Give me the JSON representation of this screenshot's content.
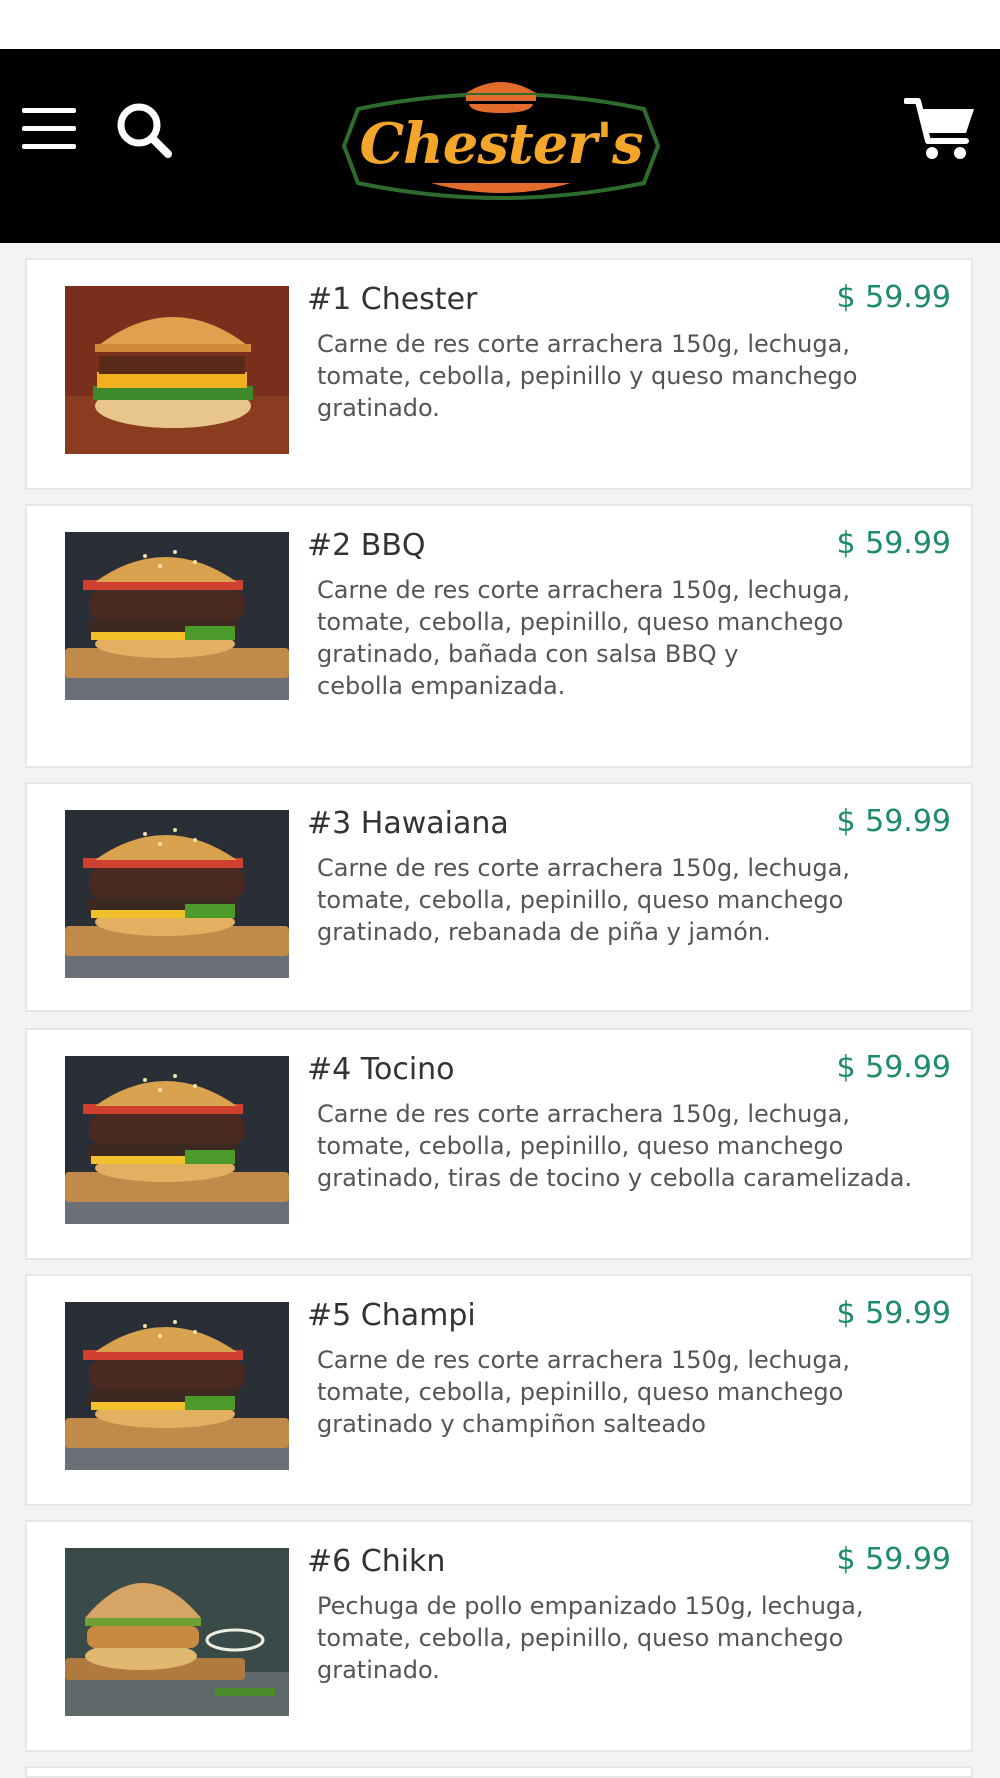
{
  "header": {
    "brand": "Chester's",
    "menu_icon": "hamburger-menu-icon",
    "search_icon": "search-icon",
    "cart_icon": "shopping-cart-icon"
  },
  "colors": {
    "header_bg": "#000000",
    "price": "#1e8a6e",
    "logo_text": "#f4a62a",
    "logo_border": "#2e6b2e",
    "logo_accent": "#e36b2c"
  },
  "menu": [
    {
      "title": "#1 Chester",
      "price": "$ 59.99",
      "lines": [
        "Carne de res corte arrachera 150g, lechuga,",
        "tomate, cebolla, pepinillo y queso manchego",
        "gratinado."
      ]
    },
    {
      "title": "#2 BBQ",
      "price": "$ 59.99",
      "lines": [
        "Carne de res corte arrachera 150g, lechuga,",
        "tomate, cebolla, pepinillo, queso manchego",
        "gratinado, bañada con salsa BBQ y",
        "cebolla empanizada."
      ]
    },
    {
      "title": "#3 Hawaiana",
      "price": "$ 59.99",
      "lines": [
        "Carne de res corte arrachera 150g, lechuga,",
        "tomate, cebolla, pepinillo, queso manchego",
        "gratinado, rebanada de piña y jamón."
      ]
    },
    {
      "title": "#4 Tocino",
      "price": "$ 59.99",
      "lines": [
        "Carne de res corte arrachera 150g, lechuga,",
        "tomate, cebolla, pepinillo, queso manchego",
        "gratinado, tiras de tocino y cebolla caramelizada."
      ]
    },
    {
      "title": "#5 Champi",
      "price": "$ 59.99",
      "lines": [
        "Carne de res corte arrachera 150g, lechuga,",
        "tomate, cebolla, pepinillo, queso manchego",
        "gratinado y champiñon salteado"
      ]
    },
    {
      "title": "#6 Chikn",
      "price": "$ 59.99",
      "lines": [
        "Pechuga de pollo empanizado 150g, lechuga,",
        "tomate, cebolla, pepinillo, queso manchego",
        "gratinado."
      ]
    }
  ]
}
